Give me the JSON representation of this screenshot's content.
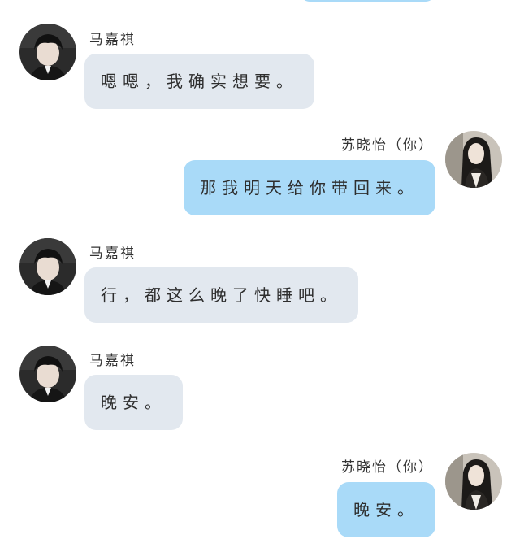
{
  "chat": {
    "contacts": {
      "other": {
        "name": "马嘉祺",
        "avatar_icon": "dark-haired-boy-avatar"
      },
      "self": {
        "name": "苏晓怡（你）",
        "avatar_icon": "long-haired-girl-avatar"
      }
    },
    "colors": {
      "other_bubble": "#e2e8ef",
      "self_bubble": "#a9daf8",
      "background": "#ffffff"
    },
    "messages": [
      {
        "sender": "马嘉祺",
        "text": "嗯嗯，我确实想要。"
      },
      {
        "sender": "苏晓怡（你）",
        "text": "那我明天给你带回来。"
      },
      {
        "sender": "马嘉祺",
        "text": "行，都这么晚了快睡吧。"
      },
      {
        "sender": "马嘉祺",
        "text": "晚安。"
      },
      {
        "sender": "苏晓怡（你）",
        "text": "晚安。"
      }
    ]
  }
}
